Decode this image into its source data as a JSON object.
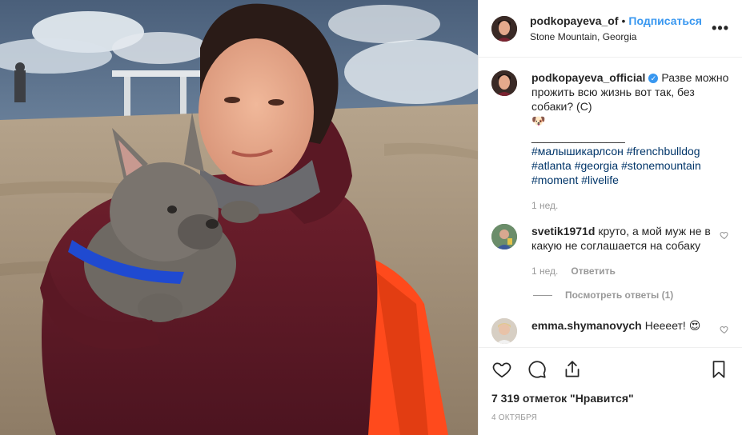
{
  "header": {
    "username": "podkopayeva_of",
    "follow_label": "Подписаться",
    "separator": "•",
    "location": "Stone Mountain, Georgia",
    "more_label": "•••"
  },
  "caption": {
    "username": "podkopayeva_official",
    "verified_mark": "✓",
    "text": "Разве можно прожить всю жизнь вот так, без собаки? (С)",
    "emoji": "🐶",
    "divider": "_______________",
    "hashtags": [
      "#малышикарлсон",
      "#frenchbulldog",
      "#atlanta",
      "#georgia",
      "#stonemountain",
      "#moment",
      "#livelife"
    ],
    "time": "1 нед."
  },
  "comments": [
    {
      "username": "svetik1971d",
      "text": "круто, а мой муж не в какую не соглашается на собаку",
      "time": "1 нед.",
      "reply_label": "Ответить",
      "view_replies": "Посмотреть ответы (1)"
    },
    {
      "username": "emma.shymanovych",
      "text": "Нееeет! 😍"
    }
  ],
  "footer": {
    "likes": "7 319 отметок \"Нравится\"",
    "date": "4 октября"
  },
  "icons": {
    "like": "heart-icon",
    "comment": "comment-icon",
    "share": "share-icon",
    "save": "bookmark-icon"
  },
  "colors": {
    "link": "#3897f0",
    "hashtag": "#003569",
    "muted": "#999999",
    "text": "#262626"
  }
}
